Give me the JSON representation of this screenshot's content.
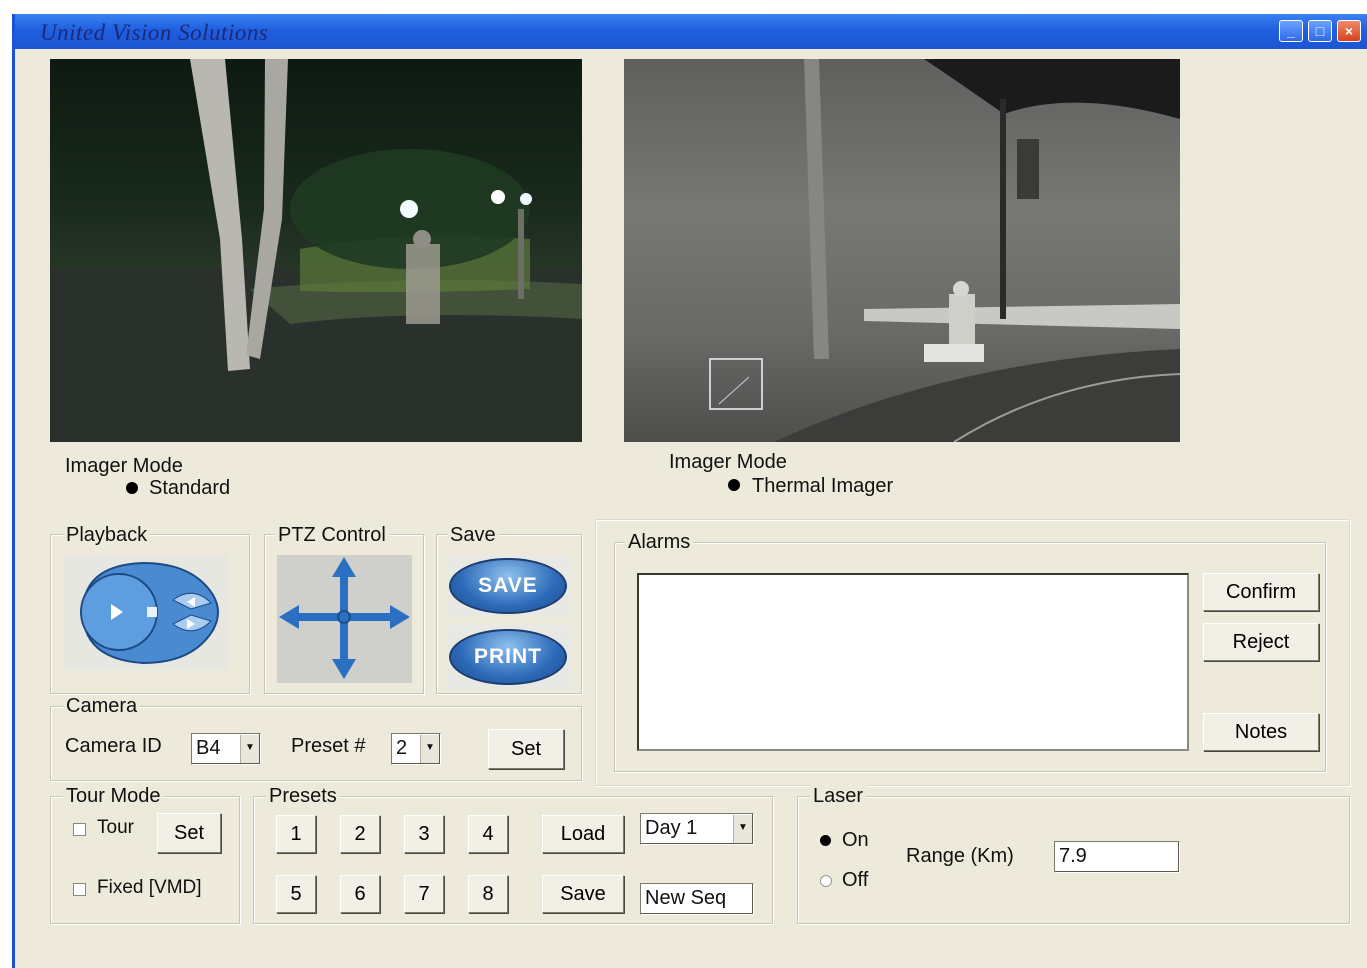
{
  "window": {
    "title": "United Vision Solutions",
    "min_glyph": "_",
    "max_glyph": "□",
    "close_glyph": "×"
  },
  "left_view": {
    "imager_mode_label": "Imager Mode",
    "mode_value": "Standard"
  },
  "right_view": {
    "imager_mode_label": "Imager Mode",
    "mode_value": "Thermal Imager"
  },
  "playback": {
    "label": "Playback"
  },
  "ptz": {
    "label": "PTZ Control"
  },
  "save_group": {
    "label": "Save",
    "save_button": "SAVE",
    "print_button": "PRINT"
  },
  "camera": {
    "label": "Camera",
    "camera_id_label": "Camera ID",
    "camera_id_value": "B4",
    "preset_label": "Preset #",
    "preset_value": "2",
    "set_button": "Set"
  },
  "alarms": {
    "label": "Alarms",
    "confirm_button": "Confirm",
    "reject_button": "Reject",
    "notes_button": "Notes"
  },
  "tour_mode": {
    "label": "Tour Mode",
    "tour_checkbox_label": "Tour",
    "set_button": "Set",
    "fixed_checkbox_label": "Fixed [VMD]"
  },
  "presets": {
    "label": "Presets",
    "buttons": [
      "1",
      "2",
      "3",
      "4",
      "5",
      "6",
      "7",
      "8"
    ],
    "load_button": "Load",
    "save_button": "Save",
    "day_value": "Day 1",
    "seq_value": "New Seq"
  },
  "laser": {
    "label": "Laser",
    "on_label": "On",
    "off_label": "Off",
    "range_label": "Range (Km)",
    "range_value": "7.9"
  },
  "colors": {
    "title_bar": "#2160e0",
    "panel_bg": "#edeadc",
    "accent_blue": "#2c6ab8"
  }
}
